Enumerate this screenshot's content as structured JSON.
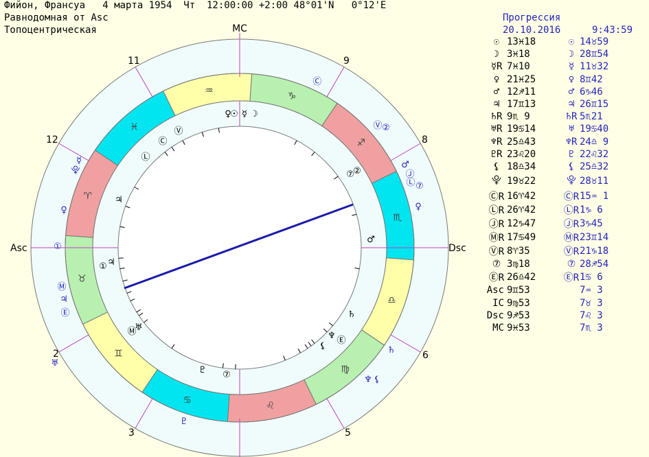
{
  "header": {
    "line1": "Фийон, Франсуа   4 марта 1954  Чт  12:00:00 +2:00 48°01'N   0°12'E",
    "line2": "Равнодомная от Asc",
    "line3": "Топоцентрическая"
  },
  "progression": {
    "title": "Прогрессия",
    "date": "20.10.2016",
    "time": "9:43:59"
  },
  "planets": [
    {
      "sym": "☉",
      "natal": "13♓18",
      "psym": "☉",
      "prog": "14♉59"
    },
    {
      "sym": "☽",
      "natal": "3♓18",
      "psym": "☽",
      "prog": "28♊54"
    },
    {
      "sym": "☿R",
      "natal": "7♓10",
      "psym": "☿",
      "prog": "11♉32"
    },
    {
      "sym": "♀",
      "natal": "21♓25",
      "psym": "♀",
      "prog": "8♊42"
    },
    {
      "sym": "♂",
      "natal": "12♐11",
      "psym": "♂",
      "prog": "6♑46"
    },
    {
      "sym": "♃",
      "natal": "17♊13",
      "psym": "♃",
      "prog": "26♊15"
    },
    {
      "sym": "♄R",
      "natal": "9♏ 9",
      "psym": "♄R",
      "prog": "5♏21"
    },
    {
      "sym": "♅R",
      "natal": "19♋14",
      "psym": "♅",
      "prog": "19♋40"
    },
    {
      "sym": "♆R",
      "natal": "25♎43",
      "psym": "♆R",
      "prog": "24♎ 9"
    },
    {
      "sym": "♇R",
      "natal": "23♌20",
      "psym": "♇",
      "prog": "22♌32"
    },
    {
      "sym": "⚸",
      "natal": "18♎34",
      "psym": "⚸",
      "prog": "25♎32"
    },
    {
      "sym": "⯓",
      "natal": "19♉22",
      "psym": "⯓",
      "prog": "28♉11"
    },
    {
      "sym": "ⒸR",
      "natal": "16♈42",
      "psym": "ⒸR",
      "prog": "15♒ 1"
    },
    {
      "sym": "ⓁR",
      "natal": "26♈42",
      "psym": "ⓁR",
      "prog": "1♑ 6"
    },
    {
      "sym": "ⒿR",
      "natal": "12♑47",
      "psym": "ⒿR",
      "prog": "3♑45"
    },
    {
      "sym": "ⓂR",
      "natal": "17♋49",
      "psym": "ⓂR",
      "prog": "23♊14"
    },
    {
      "sym": "ⓋR",
      "natal": "8♈35",
      "psym": "ⓋR",
      "prog": "21♑18"
    },
    {
      "sym": "⑦",
      "natal": "3♍18",
      "psym": "⑦",
      "prog": "28♐54"
    },
    {
      "sym": "ⒺR",
      "natal": "26♎42",
      "psym": "ⒺR",
      "prog": "1♋ 6"
    }
  ],
  "angles": [
    {
      "label": "Asc",
      "natal": "9♊53",
      "prog": "7♒ 3"
    },
    {
      "label": "IC",
      "natal": "9♍53",
      "prog": "7♉ 3"
    },
    {
      "label": "Dsc",
      "natal": "9♐53",
      "prog": "7♌ 3"
    },
    {
      "label": "MC",
      "natal": "9♓53",
      "prog": "7♏ 3"
    }
  ],
  "wheel": {
    "axis_labels": {
      "mc": "MC",
      "asc": "Asc",
      "dsc": "Dsc"
    },
    "house_numbers": [
      "2",
      "3",
      "5",
      "6",
      "8",
      "9",
      "11",
      "12"
    ],
    "signs": [
      "♓",
      "♒",
      "♑",
      "♐",
      "♏",
      "♎",
      "♍",
      "♌",
      "♋",
      "♊",
      "♉",
      "♈"
    ],
    "sign_colors": [
      "#00e5f0",
      "#ffffaa",
      "#b8f0b0",
      "#f0a0a0"
    ],
    "inner_planets": [
      "♀",
      "☉",
      "☿",
      "☽",
      "Ⓥ",
      "Ⓒ",
      "Ⓛ",
      "♃",
      "①",
      "♃",
      "Ⓜ",
      "♅",
      "♇",
      "⑦",
      "⚸",
      "♆",
      "Ⓔ",
      "♄",
      "②",
      "⑦",
      "♂"
    ],
    "outer_planets": [
      "Ⓒ",
      "Ⓥ",
      "②",
      "♂",
      "Ⓙ",
      "Ⓛ",
      "⑦",
      "♀",
      "☿",
      "⯓",
      "♀",
      "①",
      "Ⓜ",
      "♃",
      "Ⓔ",
      "♅",
      "♇",
      "♆",
      "⚸",
      "♄"
    ]
  }
}
